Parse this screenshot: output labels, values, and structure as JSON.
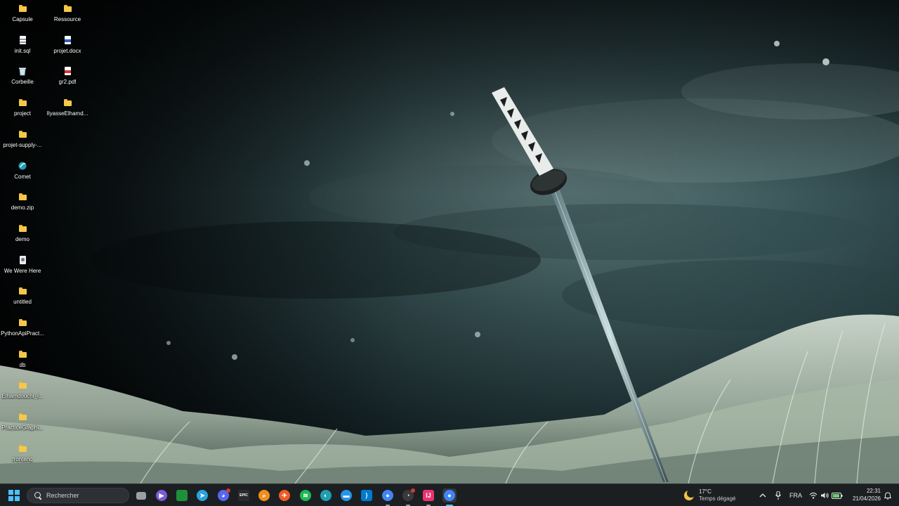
{
  "desktop": {
    "icons": [
      {
        "label": "Capsule",
        "type": "folder"
      },
      {
        "label": "Ressource",
        "type": "folder"
      },
      {
        "label": "init.sql",
        "type": "file"
      },
      {
        "label": "projet.docx",
        "type": "word"
      },
      {
        "label": "Corbeille",
        "type": "recycle-bin"
      },
      {
        "label": "gr2.pdf",
        "type": "pdf"
      },
      {
        "label": "project",
        "type": "folder"
      },
      {
        "label": "IlyasseElhamd...",
        "type": "folder"
      },
      {
        "label": "projet-supply-...",
        "type": "folder"
      },
      {
        "label": "Comet",
        "type": "app"
      },
      {
        "label": "demo.zip",
        "type": "zip"
      },
      {
        "label": "demo",
        "type": "folder"
      },
      {
        "label": "We Were Here",
        "type": "game"
      },
      {
        "label": "untitled",
        "type": "folder"
      },
      {
        "label": "PythonApiPract...",
        "type": "folder"
      },
      {
        "label": "db",
        "type": "folder"
      },
      {
        "label": "Elhamdouchi_I...",
        "type": "folder"
      },
      {
        "label": "PracticeGraphi...",
        "type": "folder"
      },
      {
        "label": "frontend",
        "type": "folder"
      }
    ]
  },
  "taskbar": {
    "search_placeholder": "Rechercher",
    "apps": [
      {
        "name": "task-view",
        "color": "#9aa0a6",
        "glyph": ""
      },
      {
        "name": "media-player",
        "color": "#7b5cd6",
        "glyph": "▶"
      },
      {
        "name": "xbox-app",
        "color": "#1f8f3a",
        "glyph": ""
      },
      {
        "name": "telegram",
        "color": "#2aa3e0",
        "glyph": "➤"
      },
      {
        "name": "discord",
        "color": "#5865f2",
        "glyph": "◕"
      },
      {
        "name": "epic-games",
        "color": "#2b2b2b",
        "glyph": "EPIC"
      },
      {
        "name": "search-tool",
        "color": "#f08c1e",
        "glyph": "⌕"
      },
      {
        "name": "postman",
        "color": "#ef5b25",
        "glyph": "✈"
      },
      {
        "name": "spotify",
        "color": "#1db954",
        "glyph": "≋"
      },
      {
        "name": "comet-browser",
        "color": "#1f9fb0",
        "glyph": "◐"
      },
      {
        "name": "docker",
        "color": "#2496ed",
        "glyph": "▬"
      },
      {
        "name": "vscode",
        "color": "#007acc",
        "glyph": "⟩"
      },
      {
        "name": "chrome",
        "color": "#4285f4",
        "glyph": "●"
      },
      {
        "name": "github-desktop",
        "color": "#3a3a3a",
        "glyph": "◔"
      },
      {
        "name": "intellij",
        "color": "#e8336e",
        "glyph": "IJ"
      },
      {
        "name": "chrome-profile",
        "color": "#4285f4",
        "glyph": "●"
      }
    ],
    "weather": {
      "temp": "17°C",
      "condition": "Temps dégagé"
    },
    "language": "FRA",
    "clock": {
      "time": "22:31",
      "date": "21/04/2026"
    }
  }
}
